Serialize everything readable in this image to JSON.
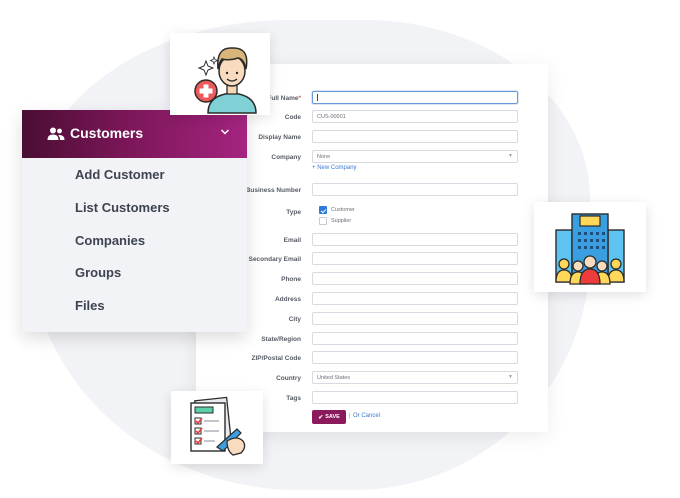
{
  "menu": {
    "title": "Customers",
    "header_icon": "users-icon",
    "chevron_icon": "chevron-down-icon",
    "items": [
      {
        "label": "Add Customer"
      },
      {
        "label": "List Customers"
      },
      {
        "label": "Companies"
      },
      {
        "label": "Groups"
      },
      {
        "label": "Files"
      }
    ]
  },
  "form": {
    "full_name": {
      "label": "Full Name",
      "required_mark": "*",
      "value": ""
    },
    "code": {
      "label": "Code",
      "value": "CUS-00001"
    },
    "display_name": {
      "label": "Display Name",
      "value": ""
    },
    "company": {
      "label": "Company",
      "value": "None",
      "new_link": "New Company"
    },
    "business_number": {
      "label": "Business Number",
      "value": ""
    },
    "type": {
      "label": "Type",
      "options": [
        {
          "label": "Customer",
          "checked": true
        },
        {
          "label": "Supplier",
          "checked": false
        }
      ]
    },
    "email": {
      "label": "Email",
      "value": ""
    },
    "secondary_email": {
      "label": "Secondary Email",
      "value": ""
    },
    "phone": {
      "label": "Phone",
      "value": ""
    },
    "address": {
      "label": "Address",
      "value": ""
    },
    "city": {
      "label": "City",
      "value": ""
    },
    "state": {
      "label": "State/Region",
      "value": ""
    },
    "zip": {
      "label": "ZIP/Postal Code",
      "value": ""
    },
    "country": {
      "label": "Country",
      "value": "United States"
    },
    "tags": {
      "label": "Tags",
      "value": ""
    },
    "save_label": "SAVE",
    "separator": "|",
    "cancel_label": "Or Cancel"
  },
  "illustrations": {
    "customer": "customer-avatar-icon",
    "company": "company-building-icon",
    "document": "contract-document-icon"
  },
  "colors": {
    "brand": "#8a1a5c",
    "menu_gradient_start": "#4a0d33",
    "menu_gradient_end": "#a52480",
    "link": "#3a7bd5",
    "checkbox": "#2f7bd6"
  }
}
